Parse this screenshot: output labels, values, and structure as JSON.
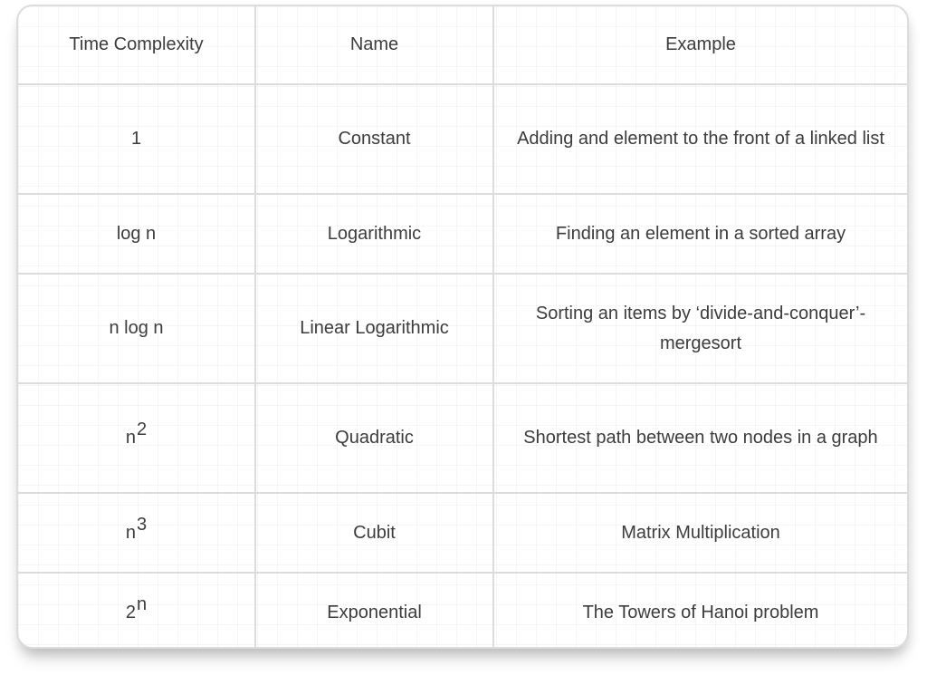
{
  "table": {
    "headers": [
      "Time Complexity",
      "Name",
      "Example"
    ],
    "rows": [
      {
        "complexity": {
          "base": "1",
          "exp": ""
        },
        "name": "Constant",
        "example": "Adding and element to the front of a linked list"
      },
      {
        "complexity": {
          "base": "log n",
          "exp": ""
        },
        "name": "Logarithmic",
        "example": "Finding an element in a sorted array"
      },
      {
        "complexity": {
          "base": "n log n",
          "exp": ""
        },
        "name": "Linear Logarithmic",
        "example": "Sorting an items by ‘divide-and-conquer’- mergesort"
      },
      {
        "complexity": {
          "base": "n",
          "exp": "2"
        },
        "name": "Quadratic",
        "example": "Shortest path between two nodes in a graph"
      },
      {
        "complexity": {
          "base": "n",
          "exp": "3"
        },
        "name": "Cubit",
        "example": "Matrix Multiplication"
      },
      {
        "complexity": {
          "base": "2",
          "exp": "n"
        },
        "name": "Exponential",
        "example": "The Towers of Hanoi problem"
      }
    ]
  }
}
